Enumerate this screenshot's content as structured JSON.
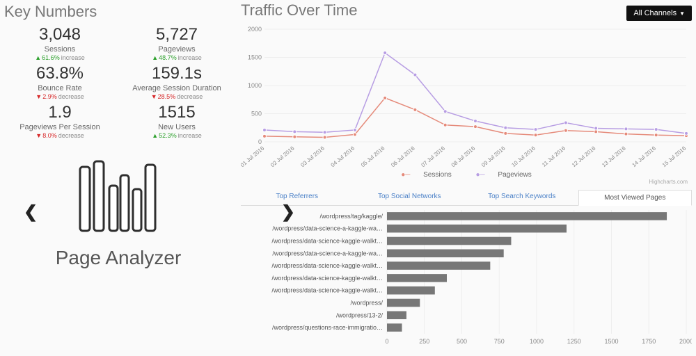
{
  "key_numbers": {
    "title": "Key Numbers",
    "items": [
      {
        "value": "3,048",
        "label": "Sessions",
        "delta": "61.6%",
        "dir": "up",
        "word": "increase"
      },
      {
        "value": "5,727",
        "label": "Pageviews",
        "delta": "48.7%",
        "dir": "up",
        "word": "increase"
      },
      {
        "value": "63.8%",
        "label": "Bounce Rate",
        "delta": "2.9%",
        "dir": "down",
        "word": "decrease"
      },
      {
        "value": "159.1s",
        "label": "Average Session Duration",
        "delta": "28.5%",
        "dir": "down",
        "word": "decrease"
      },
      {
        "value": "1.9",
        "label": "Pageviews Per Session",
        "delta": "8.0%",
        "dir": "down",
        "word": "decrease"
      },
      {
        "value": "1515",
        "label": "New Users",
        "delta": "52.3%",
        "dir": "up",
        "word": "increase"
      }
    ]
  },
  "carousel": {
    "title": "Page Analyzer"
  },
  "traffic": {
    "title": "Traffic Over Time",
    "dropdown": "All Channels",
    "watermark": "Highcharts.com",
    "legend": [
      "Sessions",
      "Pageviews"
    ]
  },
  "tabs": [
    "Top Referrers",
    "Top Social Networks",
    "Top Search Keywords",
    "Most Viewed Pages"
  ],
  "active_tab": 3,
  "chart_data": [
    {
      "type": "line",
      "title": "Traffic Over Time",
      "x": [
        "01 Jul 2016",
        "02 Jul 2016",
        "03 Jul 2016",
        "04 Jul 2016",
        "05 Jul 2016",
        "06 Jul 2016",
        "07 Jul 2016",
        "08 Jul 2016",
        "09 Jul 2016",
        "10 Jul 2016",
        "11 Jul 2016",
        "12 Jul 2016",
        "13 Jul 2016",
        "14 Jul 2016",
        "15 Jul 2016"
      ],
      "series": [
        {
          "name": "Sessions",
          "color": "#e58a7a",
          "values": [
            100,
            90,
            80,
            130,
            780,
            570,
            300,
            270,
            150,
            120,
            200,
            180,
            140,
            120,
            110
          ]
        },
        {
          "name": "Pageviews",
          "color": "#b79de3",
          "values": [
            210,
            180,
            170,
            210,
            1580,
            1190,
            540,
            370,
            250,
            220,
            340,
            240,
            230,
            220,
            150
          ]
        }
      ],
      "ylim": [
        0,
        2000
      ],
      "yticks": [
        0,
        500,
        1000,
        1500,
        2000
      ]
    },
    {
      "type": "bar",
      "title": "Most Viewed Pages",
      "categories": [
        "/wordpress/tag/kaggle/",
        "/wordpress/data-science-a-kaggle-wa…",
        "/wordpress/data-science-kaggle-walkt…",
        "/wordpress/data-science-a-kaggle-wa…",
        "/wordpress/data-science-kaggle-walkt…",
        "/wordpress/data-science-kaggle-walkt…",
        "/wordpress/data-science-kaggle-walkt…",
        "/wordpress/",
        "/wordpress/13-2/",
        "/wordpress/questions-race-immigratio…"
      ],
      "values": [
        1870,
        1200,
        830,
        780,
        690,
        400,
        320,
        220,
        130,
        100
      ],
      "xlim": [
        0,
        2000
      ],
      "xticks": [
        0,
        250,
        500,
        750,
        1000,
        1250,
        1500,
        1750,
        2000
      ]
    }
  ]
}
